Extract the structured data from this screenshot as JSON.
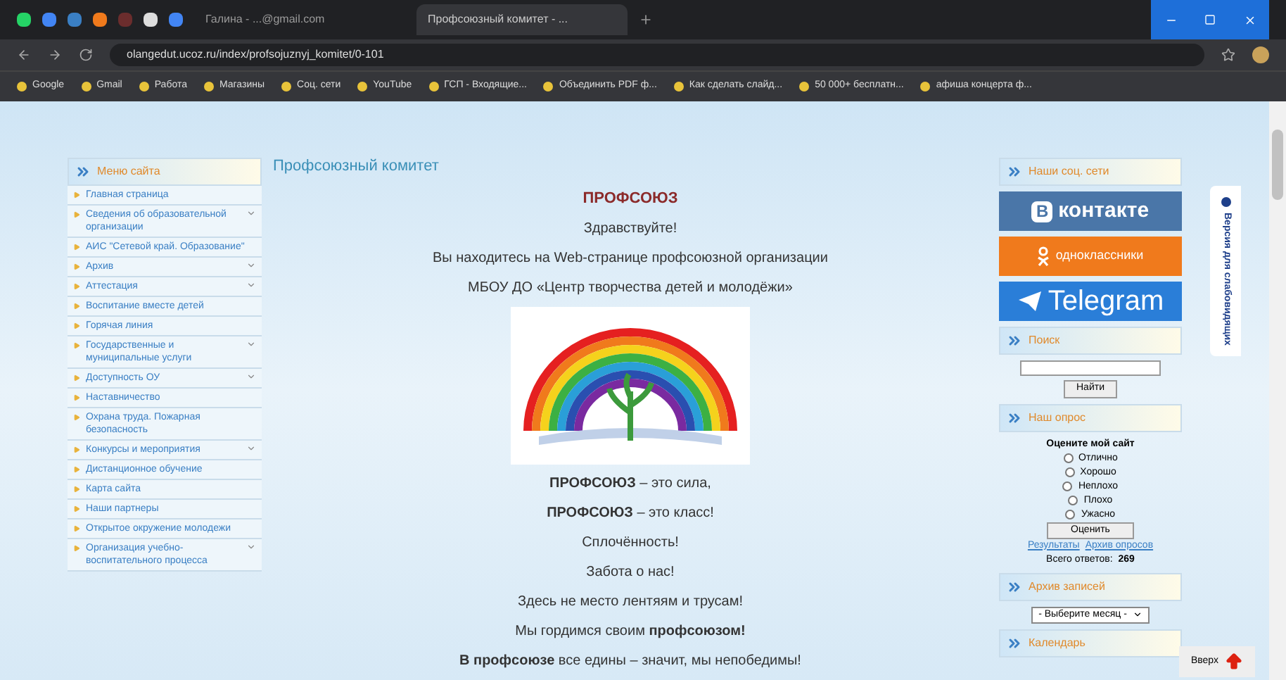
{
  "browser": {
    "tabs": [
      {
        "title": "Галина - ...@gmail.com",
        "selected": false
      },
      {
        "title": "Профсоюзный комитет - ...",
        "selected": true
      }
    ],
    "url": "olangedut.ucoz.ru/index/profsojuznyj_komitet/0-101",
    "bookmarks": [
      "Google",
      "Gmail",
      "Работа",
      "Магазины",
      "Соц. сети",
      "YouTube",
      "ГСП - Входящие...",
      "Объединить PDF ф...",
      "Как сделать слайд...",
      "50 000+ бесплатн...",
      "афиша концерта ф..."
    ]
  },
  "left_menu": {
    "title": "Меню сайта",
    "items": [
      {
        "label": "Главная страница",
        "submenu": false
      },
      {
        "label": "Сведения об образовательной организации",
        "submenu": true
      },
      {
        "label": "АИС \"Сетевой край. Образование\"",
        "submenu": false
      },
      {
        "label": "Архив",
        "submenu": true
      },
      {
        "label": "Аттестация",
        "submenu": true
      },
      {
        "label": "Воспитание вместе детей",
        "submenu": false
      },
      {
        "label": "Горячая линия",
        "submenu": false
      },
      {
        "label": "Государственные и муниципальные услуги",
        "submenu": true
      },
      {
        "label": "Доступность ОУ",
        "submenu": true
      },
      {
        "label": "Наставничество",
        "submenu": false
      },
      {
        "label": "Охрана труда. Пожарная безопасность",
        "submenu": false
      },
      {
        "label": "Конкурсы и мероприятия",
        "submenu": true
      },
      {
        "label": "Дистанционное обучение",
        "submenu": false
      },
      {
        "label": "Карта сайта",
        "submenu": false
      },
      {
        "label": "Наши партнеры",
        "submenu": false
      },
      {
        "label": "Открытое окружение молодежи",
        "submenu": false
      },
      {
        "label": "Организация учебно-воспитательного процесса",
        "submenu": true
      }
    ]
  },
  "content": {
    "heading": "Профсоюзный комитет",
    "title": "ПРОФСОЮЗ",
    "lines": [
      "Здравствуйте!",
      "Вы находитесь на Web-странице профсоюзной организации",
      "МБОУ ДО «Центр творчества детей и молодёжи»"
    ],
    "slogans": [
      "**ПРОФСОЮЗ** – это сила,",
      "**ПРОФСОЮЗ** – это класс!",
      "Сплочённость!",
      "Забота о нас!",
      "Здесь не место лентяям и трусам!",
      "Мы гордимся своим **профсоюзом!**",
      "**В профсоюзе** все едины – значит, мы непобедимы!"
    ]
  },
  "right": {
    "social": {
      "title": "Наши соц. сети",
      "buttons": [
        {
          "kind": "vk",
          "label": "контакте",
          "letter": "В"
        },
        {
          "kind": "ok",
          "label": "одноклассники"
        },
        {
          "kind": "telegram",
          "label": "Telegram"
        }
      ]
    },
    "search": {
      "title": "Поиск",
      "button": "Найти"
    },
    "poll": {
      "title": "Наш опрос",
      "question": "Оцените мой сайт",
      "options": [
        {
          "label": "Отлично",
          "selected": false
        },
        {
          "label": "Хорошо",
          "selected": false
        },
        {
          "label": "Неплохо",
          "selected": false
        },
        {
          "label": "Плохо",
          "selected": false
        },
        {
          "label": "Ужасно",
          "selected": false
        }
      ],
      "button": "Оценить",
      "results": "Результаты",
      "archive": "Архив опросов",
      "total_label": "Всего ответов:",
      "total": "269"
    },
    "archive": {
      "title": "Архив записей",
      "select": "- Выберите месяц -"
    },
    "calendar": {
      "title": "Календарь"
    }
  },
  "up_button": "Вверх",
  "accessibility_tab": "Версия для слабовидящих"
}
